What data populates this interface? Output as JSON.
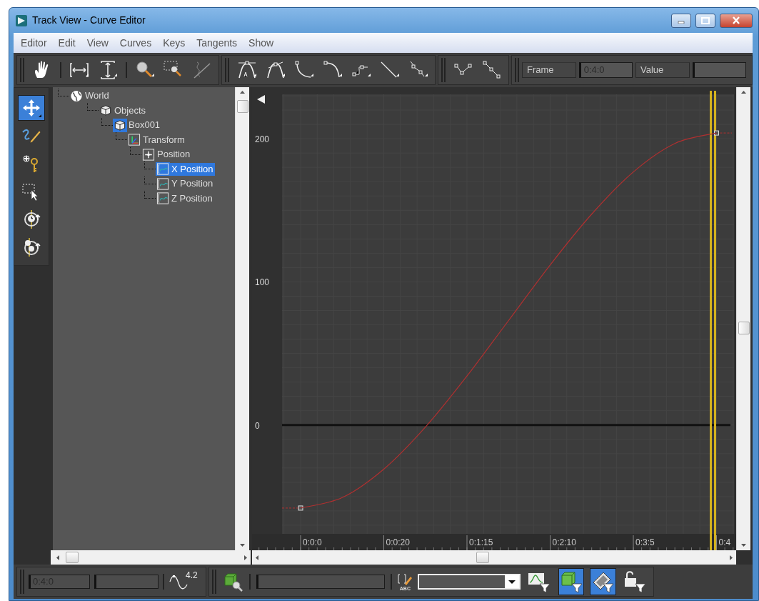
{
  "window": {
    "title": "Track View - Curve Editor"
  },
  "menu": [
    "Editor",
    "Edit",
    "View",
    "Curves",
    "Keys",
    "Tangents",
    "Show"
  ],
  "key_fields": {
    "frame_label": "Frame",
    "frame": "0:4:0",
    "value_label": "Value"
  },
  "tools": [
    {
      "kind": "move",
      "selected": true
    },
    {
      "kind": "draw",
      "selected": false
    },
    {
      "kind": "add-key",
      "selected": false
    },
    {
      "kind": "region",
      "selected": false
    },
    {
      "kind": "retime",
      "selected": false
    },
    {
      "kind": "retime-all",
      "selected": false
    }
  ],
  "tree": [
    {
      "label": "World",
      "kind": "world",
      "selected": false,
      "icon_selected": false,
      "children": [
        {
          "label": "Objects",
          "kind": "object",
          "selected": false,
          "icon_selected": false,
          "children": [
            {
              "label": "Box001",
              "kind": "object",
              "selected": false,
              "icon_selected": true,
              "children": [
                {
                  "label": "Transform",
                  "kind": "transform",
                  "selected": false,
                  "icon_selected": false,
                  "children": [
                    {
                      "label": "Position",
                      "kind": "position",
                      "selected": false,
                      "icon_selected": false,
                      "children": [
                        {
                          "label": "X Position",
                          "kind": "curve",
                          "selected": true,
                          "icon_selected": true
                        },
                        {
                          "label": "Y Position",
                          "kind": "curve",
                          "selected": false,
                          "icon_selected": false
                        },
                        {
                          "label": "Z Position",
                          "kind": "curve",
                          "selected": false,
                          "icon_selected": false
                        }
                      ]
                    }
                  ]
                }
              ]
            }
          ]
        }
      ]
    }
  ],
  "curve_editor": {
    "chart_data": {
      "type": "line",
      "categories": [
        "0:0:0",
        null,
        "0:0:20",
        null,
        "0:1:15",
        null,
        "0:2:10",
        null,
        "0:3:5",
        null,
        "0:4"
      ],
      "series": [
        {
          "color": "#b03030",
          "values": [
            -58,
            -50.7,
            -30.8,
            -1.4,
            34.2,
            73,
            111.8,
            147.4,
            176.8,
            196.7,
            204
          ]
        }
      ],
      "ylim": [
        -76,
        231
      ],
      "grid": true,
      "yticks": [
        0,
        100,
        200
      ]
    }
  },
  "status": {
    "time": "0:4:0",
    "curve_number": "4.2",
    "label_tag": "ABC",
    "filters": [
      {
        "kind": "curve",
        "selected": false
      },
      {
        "kind": "object",
        "selected": true
      },
      {
        "kind": "film",
        "selected": true
      },
      {
        "kind": "lock",
        "selected": false
      }
    ]
  }
}
